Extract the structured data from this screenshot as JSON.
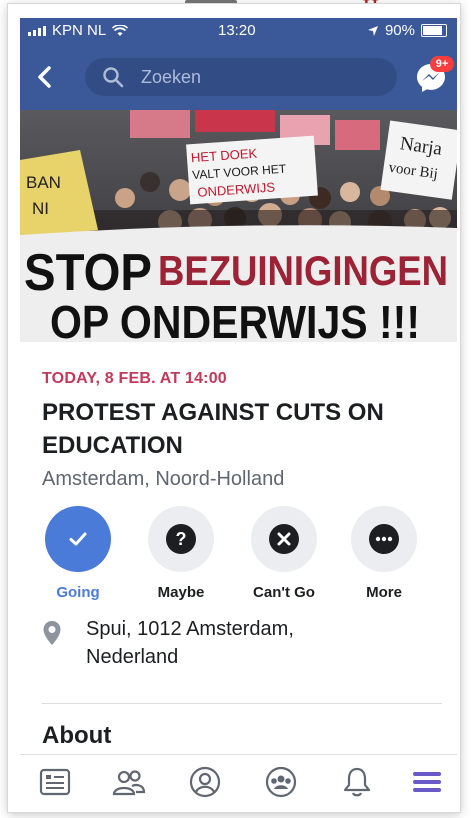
{
  "status_bar": {
    "carrier": "KPN NL",
    "time": "13:20",
    "battery": "90%"
  },
  "header": {
    "search_placeholder": "Zoeken",
    "messenger_badge": "9+"
  },
  "cover": {
    "banner_main_black": "STOP",
    "banner_main_red": "BEZUINIGINGEN",
    "banner_second": "OP ONDERWIJS !!!",
    "sign_1": [
      "HET DOEK",
      "VALT VOOR HET",
      "ONDERWIJS"
    ],
    "sign_2": [
      "Narja",
      "voor Bij"
    ],
    "sign_3": [
      "BAN",
      "NI"
    ]
  },
  "event": {
    "date": "TODAY, 8 FEB. AT 14:00",
    "title": "PROTEST AGAINST CUTS ON EDUCATION",
    "location": "Amsterdam, Noord-Holland",
    "address_line1": "Spui, 1012 Amsterdam,",
    "address_line2": "Nederland"
  },
  "actions": [
    {
      "label": "Going",
      "icon": "check-icon",
      "active": true
    },
    {
      "label": "Maybe",
      "icon": "question-icon",
      "active": false
    },
    {
      "label": "Can't Go",
      "icon": "x-icon",
      "active": false
    },
    {
      "label": "More",
      "icon": "more-icon",
      "active": false
    }
  ],
  "sections": {
    "about": "About"
  },
  "tabbar": [
    "news-feed-icon",
    "friends-icon",
    "profile-icon",
    "groups-icon",
    "notifications-icon",
    "menu-icon"
  ],
  "colors": {
    "header": "#3b5998",
    "date": "#c2395a",
    "going": "#4b7bd8",
    "menu_active": "#6a59c9"
  }
}
